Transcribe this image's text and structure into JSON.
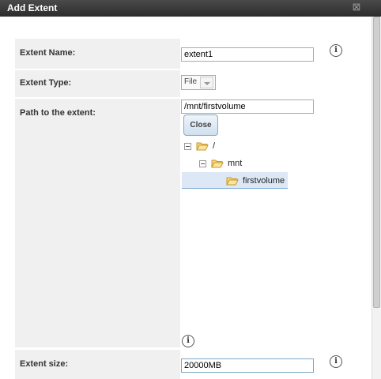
{
  "dialog": {
    "title": "Add Extent"
  },
  "form": {
    "extent_name": {
      "label": "Extent Name:",
      "value": "extent1"
    },
    "extent_type": {
      "label": "Extent Type:",
      "value": "File"
    },
    "path": {
      "label": "Path to the extent:",
      "value": "/mnt/firstvolume",
      "close_button": "Close",
      "tree": {
        "root": "/",
        "child": "mnt",
        "grandchild": "firstvolume"
      }
    },
    "extent_size": {
      "label": "Extent size:",
      "value": "20000MB"
    }
  },
  "icons": {
    "info": "i",
    "close": "⊠"
  }
}
